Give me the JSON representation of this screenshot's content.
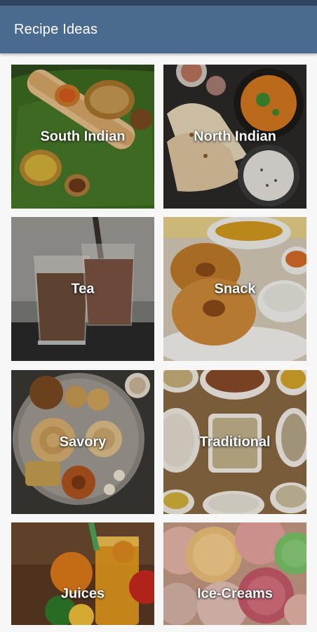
{
  "app_bar": {
    "title": "Recipe Ideas"
  },
  "categories": [
    {
      "label": "South Indian"
    },
    {
      "label": "North Indian"
    },
    {
      "label": "Tea"
    },
    {
      "label": "Snack"
    },
    {
      "label": "Savory"
    },
    {
      "label": "Traditional"
    },
    {
      "label": "Juices"
    },
    {
      "label": "Ice-Creams"
    }
  ],
  "colors": {
    "app_bar": "#4a6b8f",
    "status_bar": "#2f4560",
    "background": "#f7f7f7",
    "label_text": "#ffffff"
  }
}
